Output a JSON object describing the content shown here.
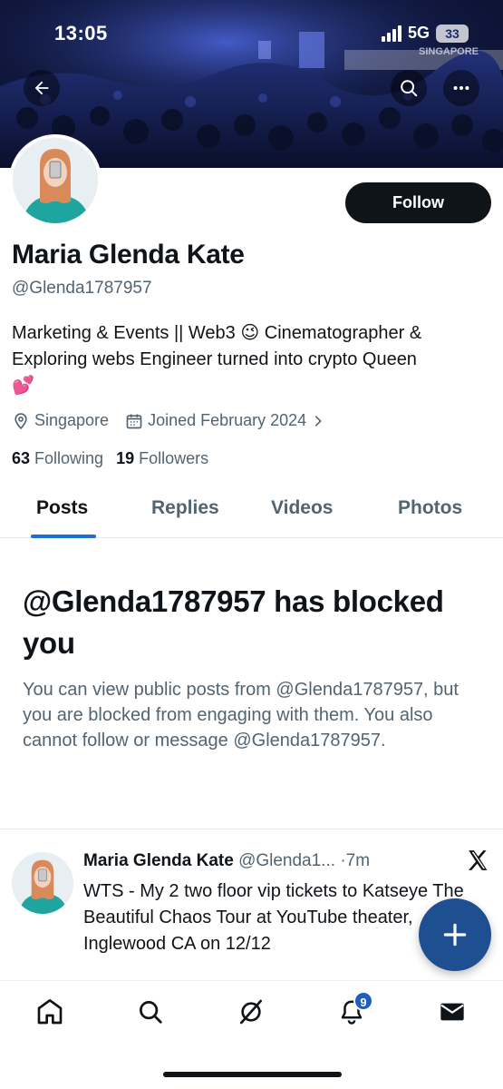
{
  "status_bar": {
    "time": "13:05",
    "network": "5G",
    "battery": "33"
  },
  "banner": {
    "signage_text": "SINGAPORE"
  },
  "top_actions": {
    "back_icon": "arrow-left-icon",
    "search_icon": "search-icon",
    "more_icon": "more-horizontal-icon"
  },
  "profile": {
    "display_name": "Maria Glenda Kate",
    "handle": "@Glenda1787957",
    "bio_line1": "Marketing & Events || Web3 😉 Cinematographer &",
    "bio_line2": "Exploring webs Engineer turned into crypto Queen",
    "bio_line3": "💕",
    "location": "Singapore",
    "joined": "Joined February 2024",
    "following_count": "63",
    "following_label": "Following",
    "followers_count": "19",
    "followers_label": "Followers",
    "follow_label": "Follow"
  },
  "tabs": [
    {
      "label": "Posts",
      "active": true
    },
    {
      "label": "Replies",
      "active": false
    },
    {
      "label": "Videos",
      "active": false
    },
    {
      "label": "Photos",
      "active": false
    }
  ],
  "blocked_notice": {
    "title": "@Glenda1787957 has blocked you",
    "message": "You can view public posts from @Glenda1787957, but you are blocked from engaging with them. You also cannot follow or message @Glenda1787957."
  },
  "post": {
    "author": "Maria Glenda Kate",
    "handle": "@Glenda1...",
    "separator": "·",
    "time": "7m",
    "text": "WTS - My 2 two floor vip tickets to Katseye The Beautiful Chaos Tour at YouTube theater, Inglewood CA on 12/12"
  },
  "compose": {
    "icon": "plus-icon"
  },
  "bottom_nav": {
    "home_icon": "home-icon",
    "search_icon": "search-icon",
    "grok_icon": "grok-icon",
    "notifications_icon": "bell-icon",
    "notifications_badge": "9",
    "messages_icon": "mail-icon"
  },
  "colors": {
    "accent": "#1d6fd0",
    "fab": "#1d4f91",
    "text_primary": "#0f1419",
    "text_secondary": "#536471"
  }
}
